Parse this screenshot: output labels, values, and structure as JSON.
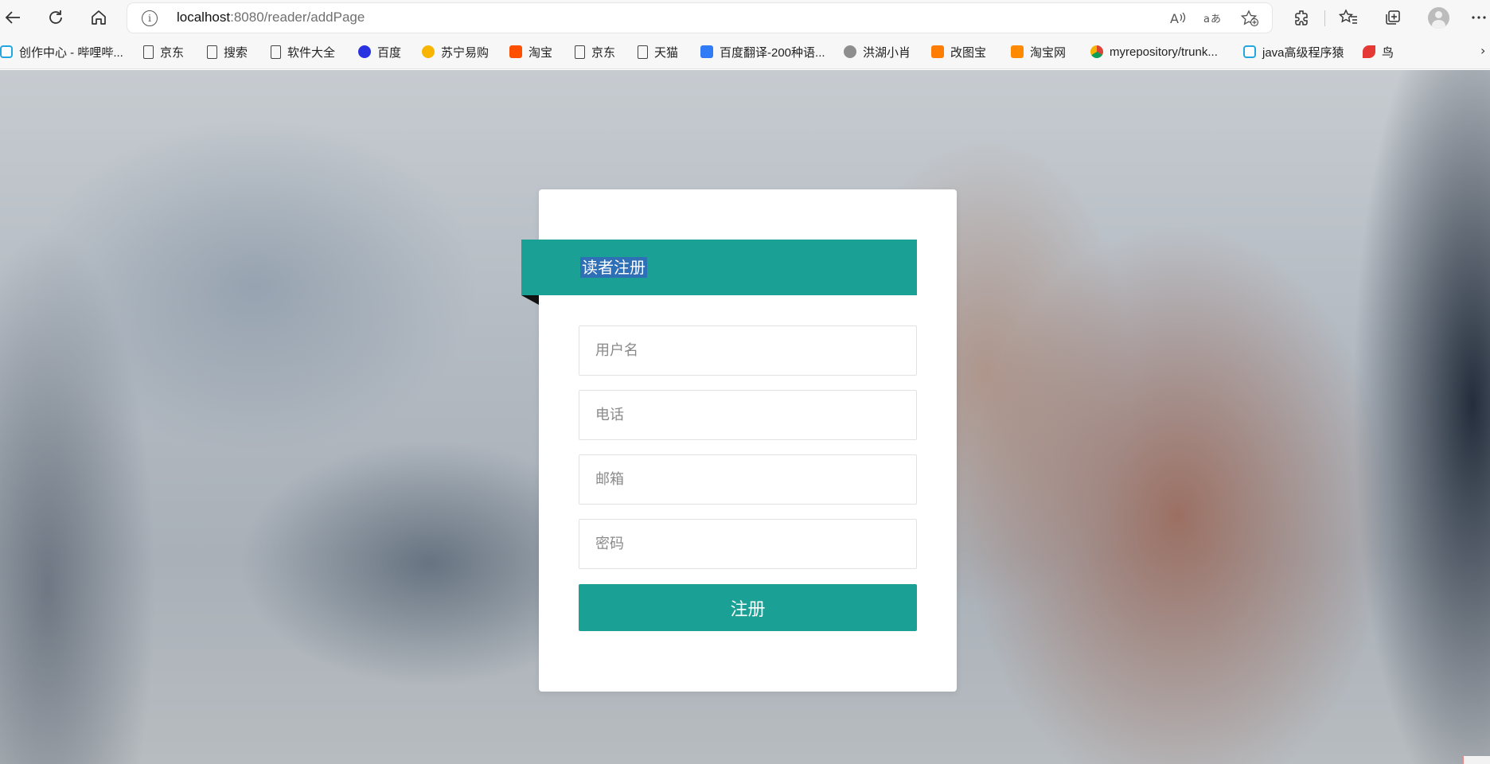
{
  "browser": {
    "url_host": "localhost",
    "url_path": ":8080/reader/addPage",
    "nav_icons": [
      "back-arrow-icon",
      "refresh-icon",
      "home-icon"
    ],
    "address_icons": [
      "read-aloud-icon",
      "translate-icon",
      "add-favorite-icon"
    ],
    "toolbar_icons": [
      "extensions-icon",
      "favorites-icon",
      "collections-icon",
      "profile-avatar",
      "more-icon"
    ]
  },
  "bookmarks": [
    {
      "label": "创作中心 - 哔哩哔...",
      "icon": "bilibili-icon"
    },
    {
      "label": "京东",
      "icon": "file-icon"
    },
    {
      "label": "搜索",
      "icon": "file-icon"
    },
    {
      "label": "软件大全",
      "icon": "file-icon"
    },
    {
      "label": "百度",
      "icon": "baidu-icon"
    },
    {
      "label": "苏宁易购",
      "icon": "suning-icon"
    },
    {
      "label": "淘宝",
      "icon": "taobao-icon"
    },
    {
      "label": "京东",
      "icon": "file-icon"
    },
    {
      "label": "天猫",
      "icon": "file-icon"
    },
    {
      "label": "百度翻译-200种语...",
      "icon": "translate-site-icon"
    },
    {
      "label": "洪湖小肖",
      "icon": "site-icon"
    },
    {
      "label": "改图宝",
      "icon": "gaitubao-icon"
    },
    {
      "label": "淘宝网",
      "icon": "taobao-icon"
    },
    {
      "label": "myrepository/trunk...",
      "icon": "chrome-icon"
    },
    {
      "label": "java高级程序猿",
      "icon": "bilibili-icon"
    },
    {
      "label": "鸟",
      "icon": "bird-icon"
    }
  ],
  "form": {
    "title": "读者注册",
    "username_placeholder": "用户名",
    "phone_placeholder": "电话",
    "email_placeholder": "邮箱",
    "password_placeholder": "密码",
    "submit_label": "注册"
  },
  "colors": {
    "accent": "#1aa094",
    "selection": "#2f6fb6"
  }
}
